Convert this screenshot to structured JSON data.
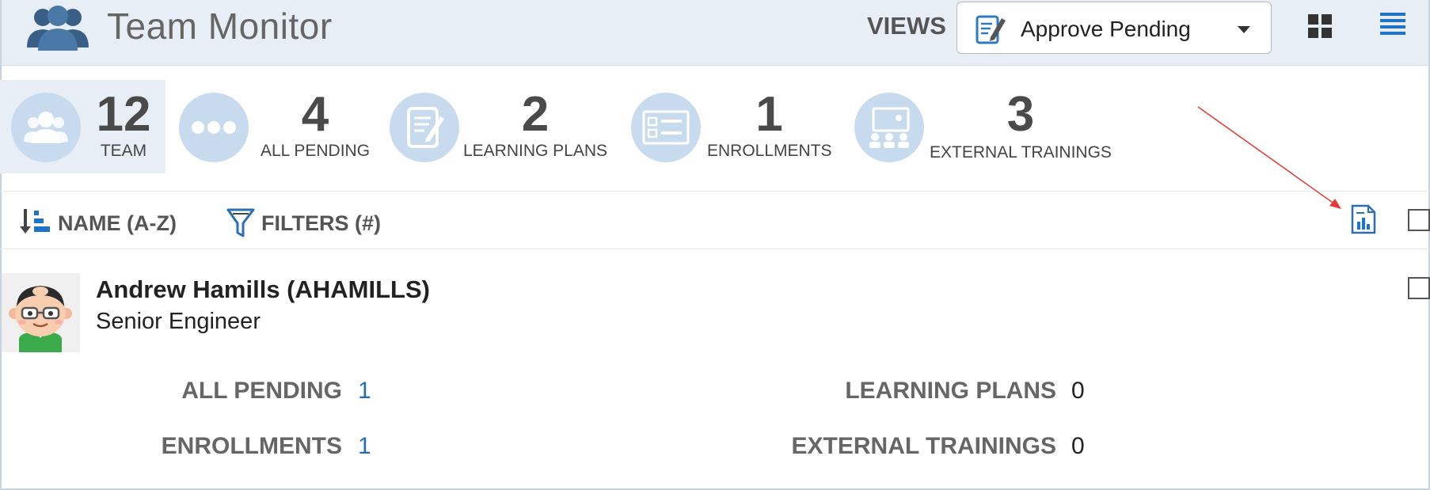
{
  "header": {
    "title": "Team Monitor",
    "views_label": "VIEWS",
    "views_selected": "Approve Pending",
    "icons": {
      "logo": "team-people-icon",
      "select": "edit-document-icon",
      "grid": "grid-view-icon",
      "list": "list-view-icon"
    }
  },
  "stats": [
    {
      "count": "12",
      "label": "TEAM",
      "icon": "team-people-icon",
      "active": true
    },
    {
      "count": "4",
      "label": "ALL PENDING",
      "icon": "ellipsis-icon",
      "active": false
    },
    {
      "count": "2",
      "label": "LEARNING PLANS",
      "icon": "learning-plan-icon",
      "active": false
    },
    {
      "count": "1",
      "label": "ENROLLMENTS",
      "icon": "enrollment-list-icon",
      "active": false
    },
    {
      "count": "3",
      "label": "EXTERNAL TRAININGS",
      "icon": "classroom-icon",
      "active": false
    }
  ],
  "toolbar": {
    "sort_label": "NAME (A-Z)",
    "filter_label": "FILTERS (#)",
    "report_icon": "report-chart-icon"
  },
  "employee": {
    "name": "Andrew Hamills (AHAMILLS)",
    "title": "Senior Engineer",
    "metrics": {
      "all_pending": {
        "label": "ALL PENDING",
        "value": "1"
      },
      "learning_plans": {
        "label": "LEARNING PLANS",
        "value": "0"
      },
      "enrollments": {
        "label": "ENROLLMENTS",
        "value": "1"
      },
      "external_trainings": {
        "label": "EXTERNAL TRAININGS",
        "value": "0"
      }
    }
  },
  "colors": {
    "header_bg": "#e8eef6",
    "icon_circle": "#c8dbee",
    "accent_blue": "#1f6fb2",
    "annotation_arrow": "#e53935"
  }
}
